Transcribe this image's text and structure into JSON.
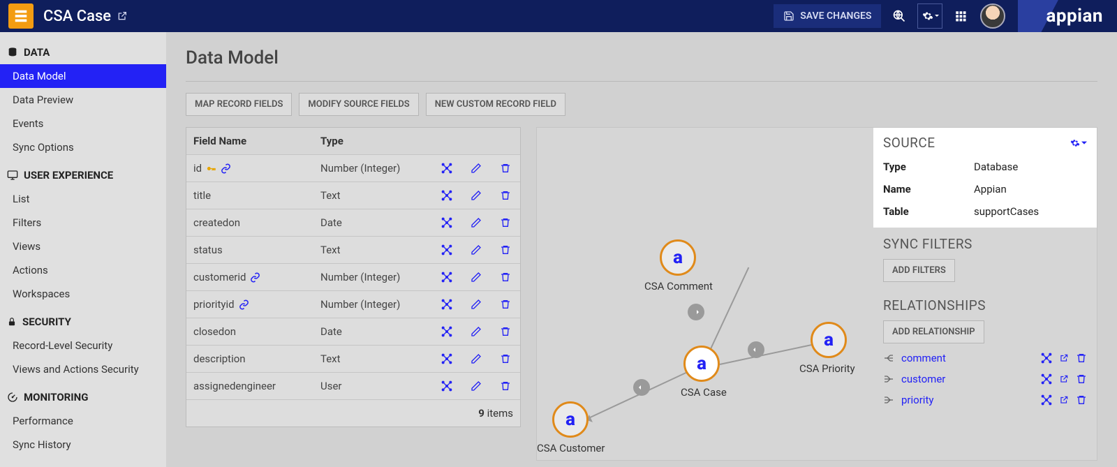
{
  "header": {
    "title": "CSA Case",
    "saveLabel": "SAVE CHANGES",
    "brand": "appian"
  },
  "sidebar": {
    "sections": [
      {
        "icon": "db",
        "label": "DATA",
        "items": [
          {
            "label": "Data Model",
            "active": true
          },
          {
            "label": "Data Preview"
          },
          {
            "label": "Events"
          },
          {
            "label": "Sync Options"
          }
        ]
      },
      {
        "icon": "monitor",
        "label": "USER EXPERIENCE",
        "items": [
          {
            "label": "List"
          },
          {
            "label": "Filters"
          },
          {
            "label": "Views"
          },
          {
            "label": "Actions"
          },
          {
            "label": "Workspaces"
          }
        ]
      },
      {
        "icon": "lock",
        "label": "SECURITY",
        "items": [
          {
            "label": "Record-Level Security"
          },
          {
            "label": "Views and Actions Security"
          }
        ]
      },
      {
        "icon": "gauge",
        "label": "MONITORING",
        "items": [
          {
            "label": "Performance"
          },
          {
            "label": "Sync History"
          }
        ]
      }
    ]
  },
  "page": {
    "title": "Data Model",
    "buttons": [
      "MAP RECORD FIELDS",
      "MODIFY SOURCE FIELDS",
      "NEW CUSTOM RECORD FIELD"
    ]
  },
  "table": {
    "cols": [
      "Field Name",
      "Type"
    ],
    "rows": [
      {
        "name": "id",
        "type": "Number (Integer)",
        "key": true,
        "link": true
      },
      {
        "name": "title",
        "type": "Text"
      },
      {
        "name": "createdon",
        "type": "Date"
      },
      {
        "name": "status",
        "type": "Text"
      },
      {
        "name": "customerid",
        "type": "Number (Integer)",
        "link": true
      },
      {
        "name": "priorityid",
        "type": "Number (Integer)",
        "link": true
      },
      {
        "name": "closedon",
        "type": "Date"
      },
      {
        "name": "description",
        "type": "Text"
      },
      {
        "name": "assignedengineer",
        "type": "User"
      }
    ],
    "count": "9",
    "itemsLabel": "items"
  },
  "diagram": {
    "nodes": [
      {
        "id": "case",
        "label": "CSA Case",
        "center": true
      },
      {
        "id": "comment",
        "label": "CSA Comment"
      },
      {
        "id": "priority",
        "label": "CSA Priority"
      },
      {
        "id": "customer",
        "label": "CSA Customer"
      }
    ]
  },
  "source": {
    "heading": "SOURCE",
    "typeLabel": "Type",
    "typeValue": "Database",
    "nameLabel": "Name",
    "nameValue": "Appian",
    "tableLabel": "Table",
    "tableValue": "supportCases"
  },
  "syncFilters": {
    "heading": "SYNC FILTERS",
    "button": "ADD FILTERS"
  },
  "relationships": {
    "heading": "RELATIONSHIPS",
    "button": "ADD RELATIONSHIP",
    "items": [
      {
        "name": "comment",
        "type": "one-to-many"
      },
      {
        "name": "customer",
        "type": "many-to-one"
      },
      {
        "name": "priority",
        "type": "many-to-one"
      }
    ]
  }
}
